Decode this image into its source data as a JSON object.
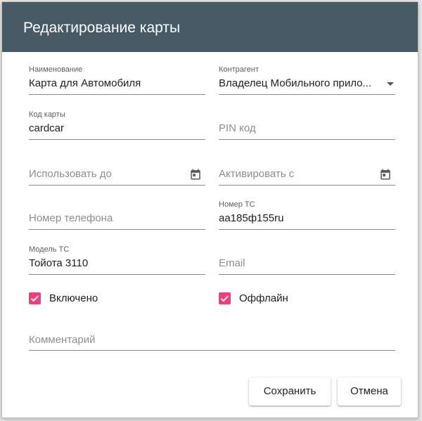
{
  "dialog": {
    "title": "Редактирование карты"
  },
  "fields": {
    "name": {
      "label": "Наименование",
      "value": "Карта для Автомобиля"
    },
    "counterparty": {
      "label": "Контрагент",
      "value": "Владелец Мобильного прило..."
    },
    "card_code": {
      "label": "Код карты",
      "value": "cardcar"
    },
    "pin": {
      "placeholder": "PIN код"
    },
    "use_until": {
      "placeholder": "Использовать до"
    },
    "activate_from": {
      "placeholder": "Активировать с"
    },
    "phone": {
      "placeholder": "Номер телефона"
    },
    "vehicle_number": {
      "label": "Номер ТС",
      "value": "аа185ф155ru"
    },
    "vehicle_model": {
      "label": "Модель ТС",
      "value": "Тойота 3110"
    },
    "email": {
      "placeholder": "Email"
    },
    "comment": {
      "placeholder": "Комментарий"
    }
  },
  "checkboxes": {
    "enabled": {
      "label": "Включено",
      "checked": true
    },
    "offline": {
      "label": "Оффлайн",
      "checked": true
    }
  },
  "buttons": {
    "save": "Сохранить",
    "cancel": "Отмена"
  },
  "colors": {
    "header_bg": "#455a64",
    "checkbox_accent": "#ef3e7b"
  },
  "icons": {
    "date_picker": "calendar-icon",
    "dropdown": "chevron-down-icon",
    "checked": "checkmark-icon"
  }
}
